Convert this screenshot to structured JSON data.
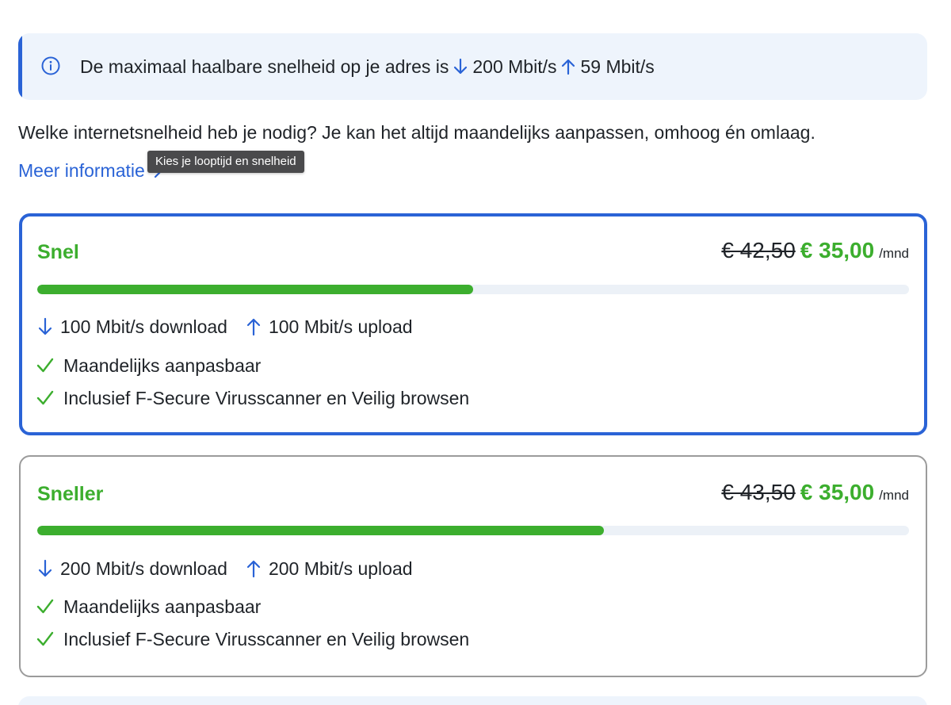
{
  "banner": {
    "text_prefix": "De maximaal haalbare snelheid op je adres is",
    "download": "200 Mbit/s",
    "upload": "59 Mbit/s"
  },
  "question": "Welke internetsnelheid heb je nodig? Je kan het altijd maandelijks aanpassen, omhoog én omlaag.",
  "more_info_link": "Meer informatie",
  "tooltip": "Kies je looptijd en snelheid",
  "plans": [
    {
      "name": "Snel",
      "old_price": "€ 42,50",
      "new_price": "€ 35,00",
      "unit": "/mnd",
      "speed_level": 0.5,
      "download": "100 Mbit/s download",
      "upload": "100 Mbit/s upload",
      "features": [
        "Maandelijks aanpasbaar",
        "Inclusief F-Secure Virusscanner en Veilig browsen"
      ],
      "selected": true
    },
    {
      "name": "Sneller",
      "old_price": "€ 43,50",
      "new_price": "€ 35,00",
      "unit": "/mnd",
      "speed_level": 0.65,
      "download": "200 Mbit/s download",
      "upload": "200 Mbit/s upload",
      "features": [
        "Maandelijks aanpasbaar",
        "Inclusief F-Secure Virusscanner en Veilig browsen"
      ],
      "selected": false
    }
  ],
  "colors": {
    "accent_blue": "#2a63d6",
    "brand_green": "#3cae2e",
    "banner_bg": "#eef4fc"
  },
  "icons": {
    "info": "info-circle-icon",
    "download": "arrow-down-icon",
    "upload": "arrow-up-icon",
    "check": "checkmark-icon",
    "chevron": "chevron-right-icon"
  }
}
